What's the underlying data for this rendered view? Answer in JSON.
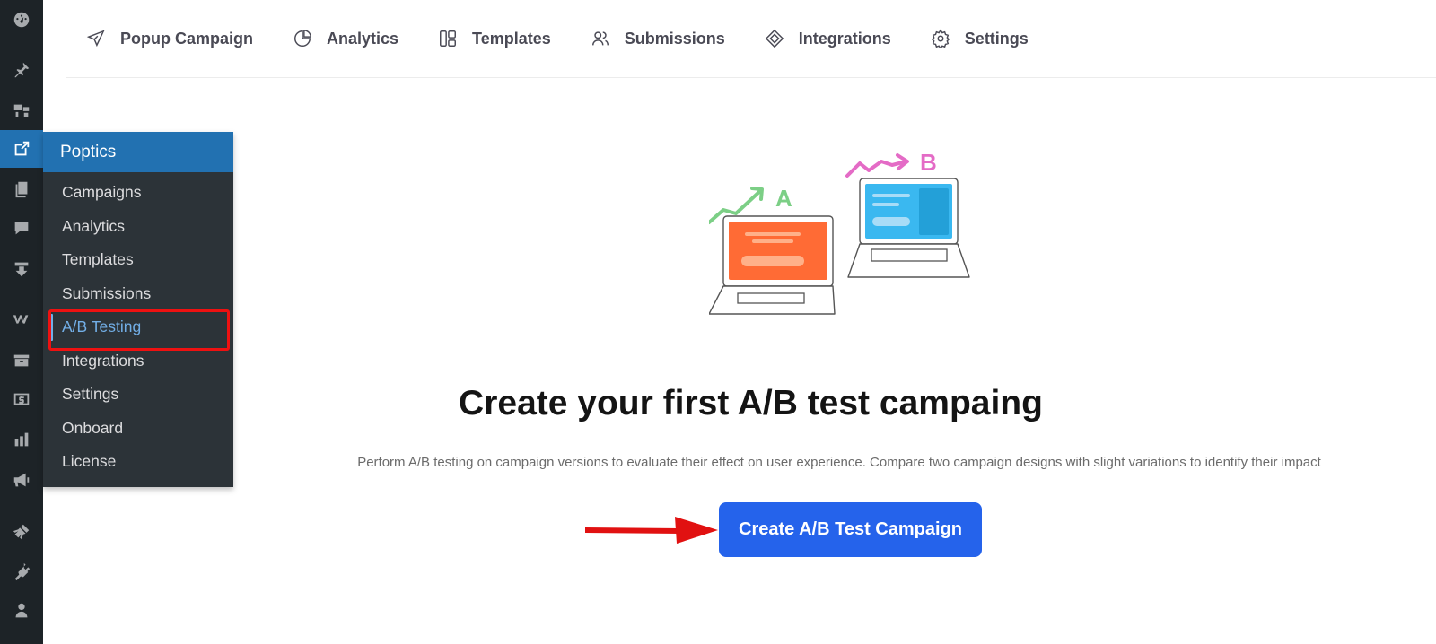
{
  "rail": {
    "icons": [
      "dashboard-icon",
      "pin-icon",
      "media-icon",
      "poptics-icon",
      "pages-icon",
      "comments-icon",
      "download-icon",
      "woo-icon",
      "archive-icon",
      "dollar-icon",
      "stats-icon",
      "megaphone-icon",
      "brush-icon",
      "plugin-icon",
      "user-icon"
    ]
  },
  "flyout": {
    "title": "Poptics",
    "items": [
      "Campaigns",
      "Analytics",
      "Templates",
      "Submissions",
      "A/B Testing",
      "Integrations",
      "Settings",
      "Onboard",
      "License"
    ],
    "current": "A/B Testing"
  },
  "topnav": {
    "items": [
      {
        "label": "Popup Campaign",
        "icon": "send-icon"
      },
      {
        "label": "Analytics",
        "icon": "pie-chart-icon"
      },
      {
        "label": "Templates",
        "icon": "layout-icon"
      },
      {
        "label": "Submissions",
        "icon": "users-icon"
      },
      {
        "label": "Integrations",
        "icon": "diamond-icon"
      },
      {
        "label": "Settings",
        "icon": "gear-icon"
      }
    ]
  },
  "main": {
    "illustration": {
      "label_a": "A",
      "label_b": "B"
    },
    "heading": "Create your first A/B test campaing",
    "description": "Perform A/B testing on campaign versions to evaluate their effect on user experience. Compare two campaign designs with slight variations to identify their impact",
    "cta_label": "Create A/B Test Campaign"
  },
  "colors": {
    "wp_rail": "#1d2327",
    "wp_flyout": "#2c3338",
    "wp_blue": "#2271b1",
    "cta_blue": "#2563eb",
    "annotation_red": "#e11111",
    "variant_a": "#ff6b35",
    "variant_b": "#3ab8f0",
    "trend_a": "#7ccf86",
    "trend_b": "#e46bc6"
  }
}
